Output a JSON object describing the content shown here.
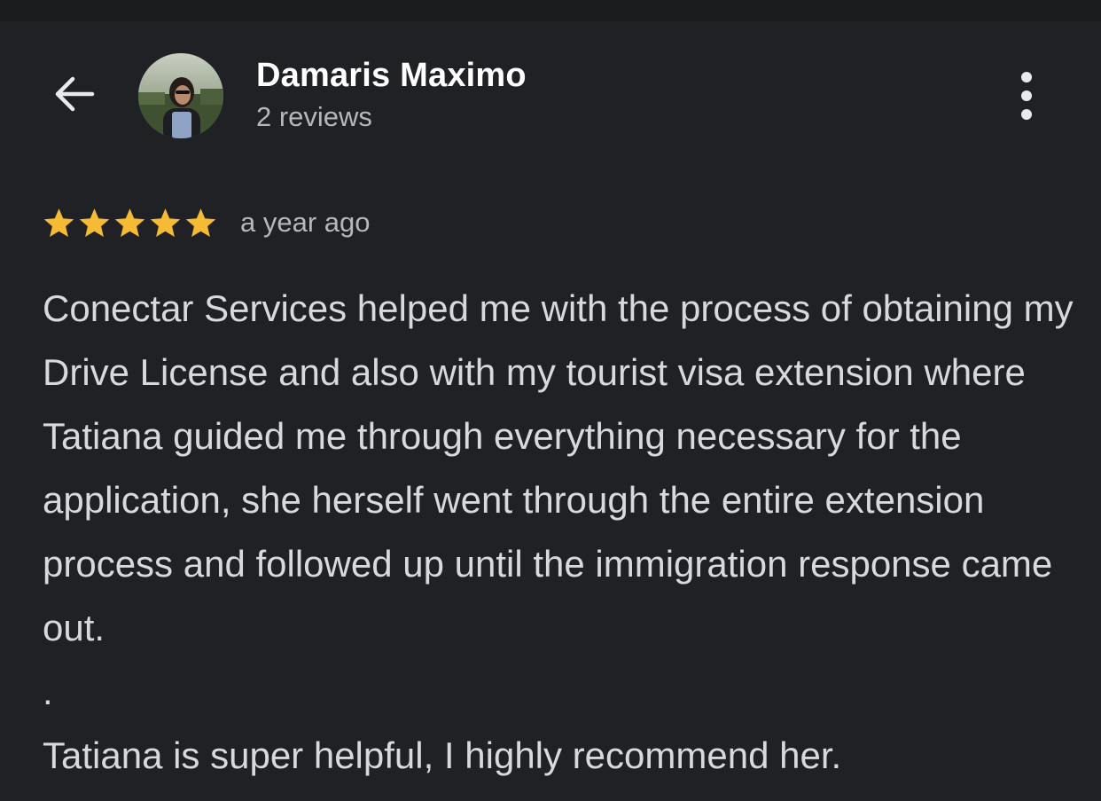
{
  "header": {
    "back_icon": "arrow-left-icon",
    "reviewer_name": "Damaris Maximo",
    "review_count": "2 reviews",
    "more_icon": "more-vertical-icon"
  },
  "review": {
    "rating": 5,
    "rating_max": 5,
    "star_color": "#f6bb34",
    "time": "a year ago",
    "paragraphs": [
      "Conectar Services helped me with the process of obtaining my Drive License and also with my tourist visa extension where Tatiana guided me through everything necessary for the application, she herself went through the entire extension process and followed up until the immigration response came out.",
      ".",
      "Tatiana is super helpful, I highly recommend her."
    ]
  },
  "colors": {
    "background": "#202124",
    "text_primary": "#ffffff",
    "text_secondary": "#b5b7ba",
    "text_body": "#d7d9dc"
  }
}
